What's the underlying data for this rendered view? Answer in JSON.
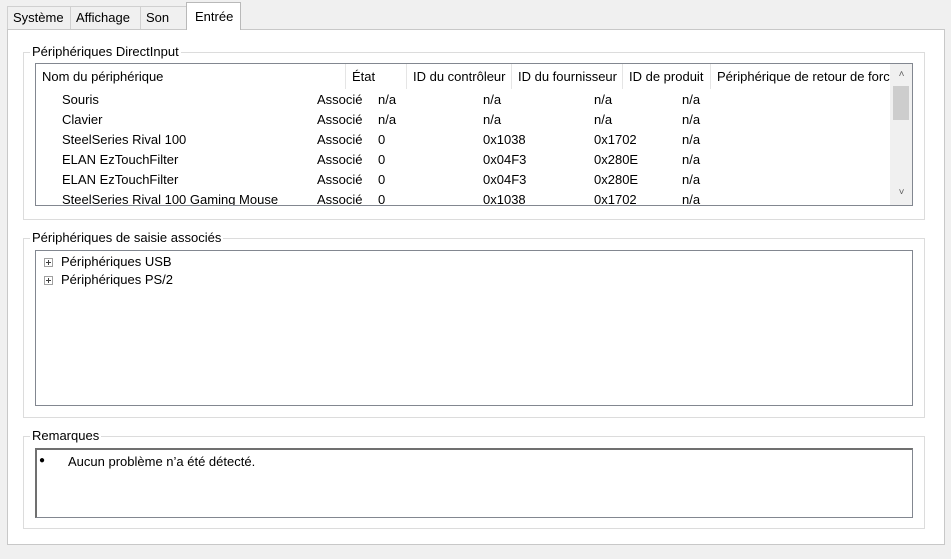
{
  "tabs": [
    {
      "label": "Système"
    },
    {
      "label": "Affichage"
    },
    {
      "label": "Son"
    },
    {
      "label": "Entrée"
    }
  ],
  "active_tab": "Entrée",
  "directinput": {
    "title": "Périphériques DirectInput",
    "columns": [
      "Nom du périphérique",
      "État",
      "ID du contrôleur",
      "ID du fournisseur",
      "ID de produit",
      "Périphérique de retour de force"
    ],
    "rows": [
      [
        "Souris",
        "Associé",
        "n/a",
        "n/a",
        "n/a",
        "n/a"
      ],
      [
        "Clavier",
        "Associé",
        "n/a",
        "n/a",
        "n/a",
        "n/a"
      ],
      [
        "SteelSeries Rival 100",
        "Associé",
        "0",
        "0x1038",
        "0x1702",
        "n/a"
      ],
      [
        "ELAN EzTouchFilter",
        "Associé",
        "0",
        "0x04F3",
        "0x280E",
        "n/a"
      ],
      [
        "ELAN EzTouchFilter",
        "Associé",
        "0",
        "0x04F3",
        "0x280E",
        "n/a"
      ],
      [
        "SteelSeries Rival 100 Gaming Mouse",
        "Associé",
        "0",
        "0x1038",
        "0x1702",
        "n/a"
      ]
    ]
  },
  "input_devices": {
    "title": "Périphériques de saisie associés",
    "items": [
      {
        "label": "Périphériques USB"
      },
      {
        "label": "Périphériques PS/2"
      }
    ]
  },
  "notes": {
    "title": "Remarques",
    "items": [
      "Aucun problème n’a été détecté."
    ]
  }
}
